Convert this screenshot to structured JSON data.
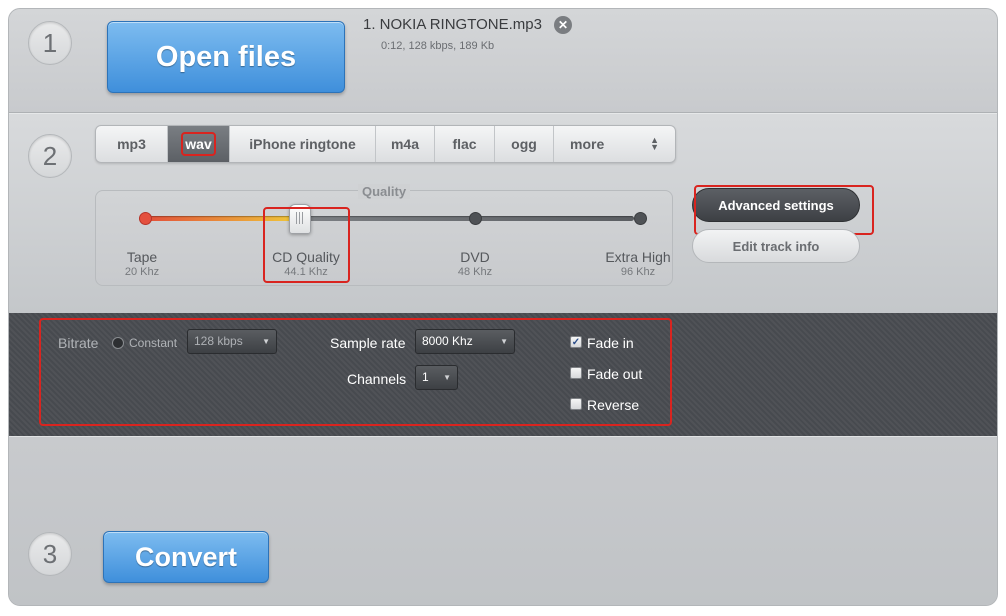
{
  "steps": {
    "one": "1",
    "two": "2",
    "three": "3"
  },
  "open_button": "Open files",
  "file": {
    "name": "1. NOKIA RINGTONE.mp3",
    "meta": "0:12, 128 kbps, 189 Kb"
  },
  "formats": {
    "tabs": [
      "mp3",
      "wav",
      "iPhone ringtone",
      "m4a",
      "flac",
      "ogg",
      "more"
    ],
    "selected": "wav"
  },
  "quality": {
    "label": "Quality",
    "levels": [
      {
        "name": "Tape",
        "khz": "20 Khz"
      },
      {
        "name": "CD Quality",
        "khz": "44.1 Khz"
      },
      {
        "name": "DVD",
        "khz": "48 Khz"
      },
      {
        "name": "Extra High",
        "khz": "96 Khz"
      }
    ],
    "selected_index": 1
  },
  "side_buttons": {
    "advanced": "Advanced settings",
    "edit": "Edit track info"
  },
  "advanced": {
    "bitrate_label": "Bitrate",
    "constant_label": "Constant",
    "bitrate_value": "128 kbps",
    "sample_rate_label": "Sample rate",
    "sample_rate_value": "8000 Khz",
    "channels_label": "Channels",
    "channels_value": "1",
    "options": [
      {
        "label": "Fade in",
        "checked": true
      },
      {
        "label": "Fade out",
        "checked": false
      },
      {
        "label": "Reverse",
        "checked": false
      }
    ]
  },
  "convert_button": "Convert",
  "colors": {
    "accent_blue": "#4a9be3",
    "highlight_red": "#d9241f",
    "panel_dark": "#4a4d52"
  }
}
